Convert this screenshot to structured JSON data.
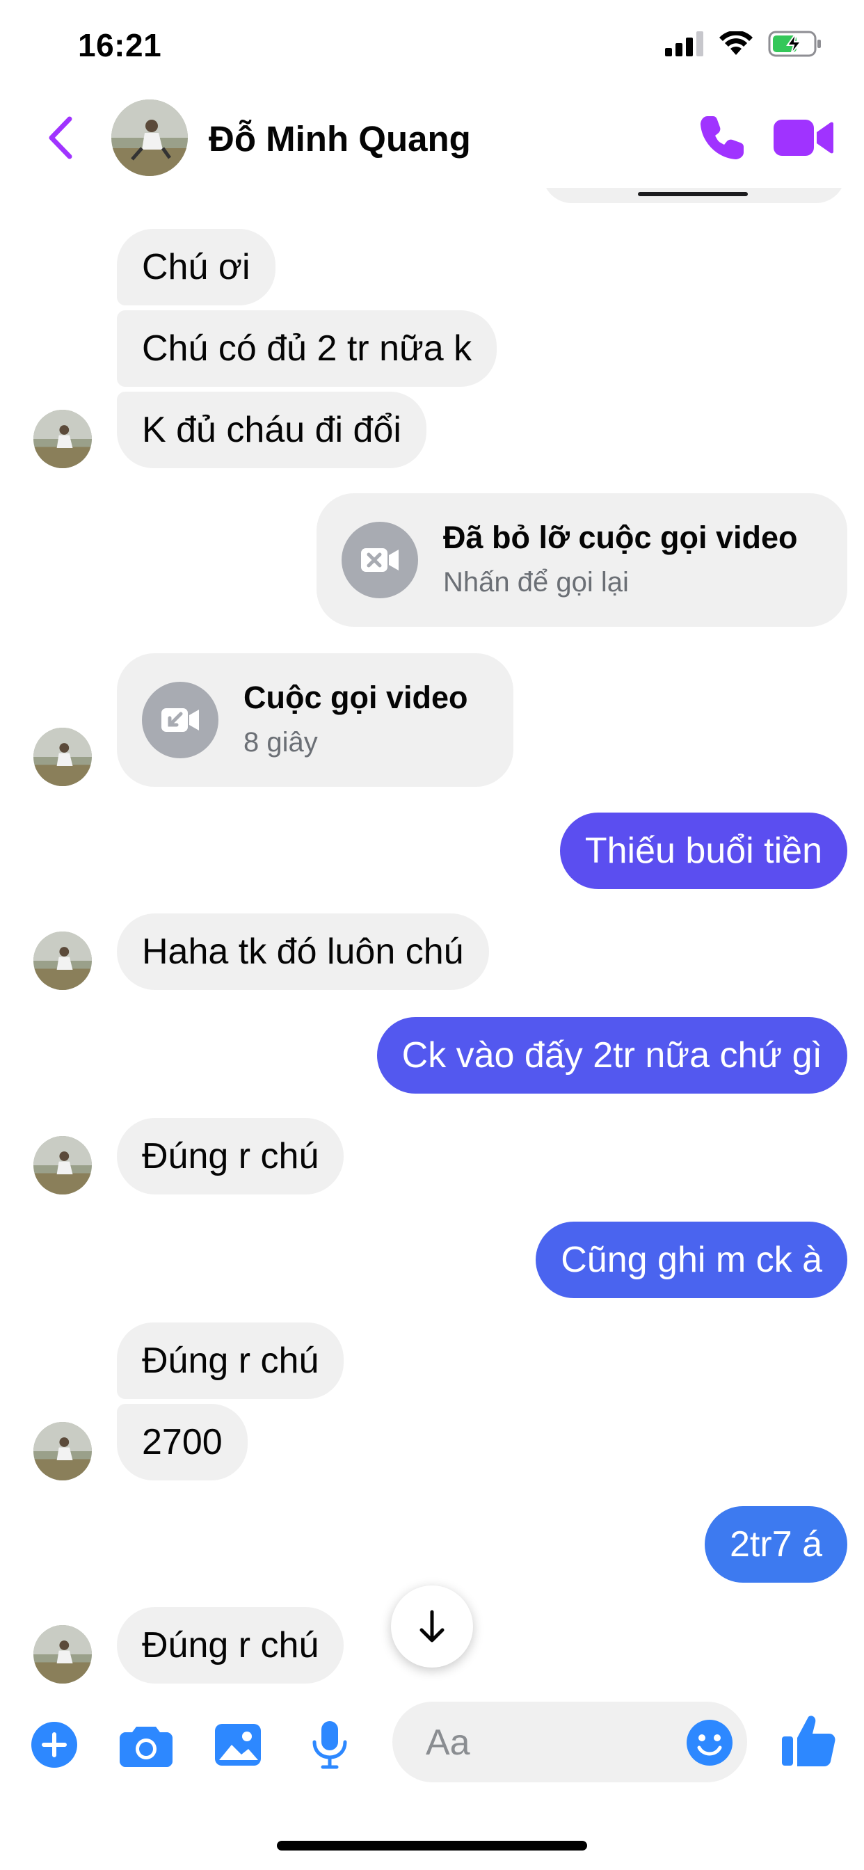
{
  "status_bar": {
    "time": "16:21"
  },
  "header": {
    "contact_name": "Đỗ Minh Quang"
  },
  "colors": {
    "accent_purple": "#a033ff",
    "outgoing_gradient": [
      "#5b4ef0",
      "#4f64ef",
      "#3d7af0"
    ],
    "incoming_bubble": "#f0f0f0",
    "icon_blue": "#2d88ff",
    "call_icon_bg": "#a8abb2"
  },
  "messages": [
    {
      "id": "m1",
      "text": "Chú ơi"
    },
    {
      "id": "m2",
      "text": "Chú có đủ 2 tr nữa k"
    },
    {
      "id": "m3",
      "text": "K đủ cháu đi đổi"
    },
    {
      "id": "m4",
      "call_title": "Đã bỏ lỡ cuộc gọi video",
      "call_subtitle": "Nhấn để gọi lại"
    },
    {
      "id": "m5",
      "call_title": "Cuộc gọi video",
      "call_subtitle": "8 giây"
    },
    {
      "id": "m6",
      "text": "Thiếu buổi tiền"
    },
    {
      "id": "m7",
      "text": "Haha tk đó luôn chú"
    },
    {
      "id": "m8",
      "text": "Ck vào đấy 2tr nữa chứ gì"
    },
    {
      "id": "m9",
      "text": "Đúng r chú"
    },
    {
      "id": "m10",
      "text": "Cũng ghi m ck à"
    },
    {
      "id": "m11",
      "text": "Đúng r chú"
    },
    {
      "id": "m12",
      "text": "2700"
    },
    {
      "id": "m13",
      "text": "2tr7 á"
    },
    {
      "id": "m14",
      "text": "Đúng r chú"
    }
  ],
  "composer": {
    "placeholder": "Aa"
  }
}
